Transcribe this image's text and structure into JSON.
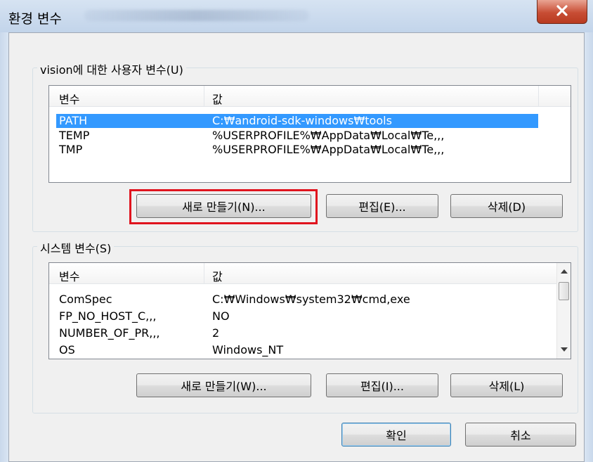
{
  "window": {
    "title": "환경 변수",
    "close_icon": "close-icon"
  },
  "user_vars": {
    "legend": "vision에 대한 사용자 변수(U)",
    "columns": [
      "변수",
      "값"
    ],
    "rows": [
      {
        "name": "PATH",
        "value": "C:₩android-sdk-windows₩tools",
        "selected": true
      },
      {
        "name": "TEMP",
        "value": "%USERPROFILE%₩AppData₩Local₩Te,,,"
      },
      {
        "name": "TMP",
        "value": "%USERPROFILE%₩AppData₩Local₩Te,,,"
      }
    ],
    "buttons": {
      "new": "새로 만들기(N)...",
      "edit": "편집(E)...",
      "delete": "삭제(D)"
    }
  },
  "system_vars": {
    "legend": "시스템 변수(S)",
    "columns": [
      "변수",
      "값"
    ],
    "rows": [
      {
        "name": "ComSpec",
        "value": "C:₩Windows₩system32₩cmd,exe"
      },
      {
        "name": "FP_NO_HOST_C,,,",
        "value": "NO"
      },
      {
        "name": "NUMBER_OF_PR,,,",
        "value": "2"
      },
      {
        "name": "OS",
        "value": "Windows_NT"
      }
    ],
    "buttons": {
      "new": "새로 만들기(W)...",
      "edit": "편집(I)...",
      "delete": "삭제(L)"
    }
  },
  "dialog_buttons": {
    "ok": "확인",
    "cancel": "취소"
  },
  "colors": {
    "selection": "#3399ff",
    "highlight": "#e0141e",
    "close_button": "#c84d34"
  }
}
